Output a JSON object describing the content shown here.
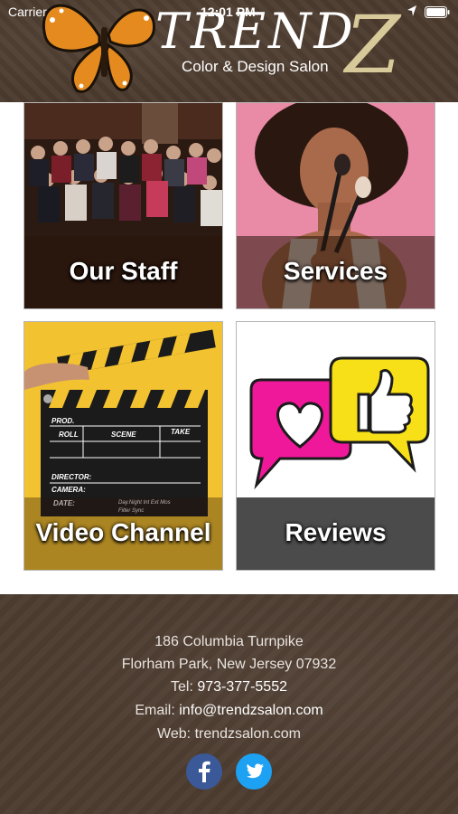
{
  "status_bar": {
    "carrier": "Carrier",
    "time": "12:01 PM"
  },
  "brand": {
    "name": "TREND",
    "z": "Z",
    "subtitle": "Color & Design Salon"
  },
  "tiles": [
    {
      "label": "Our Staff"
    },
    {
      "label": "Services"
    },
    {
      "label": "Video Channel"
    },
    {
      "label": "Reviews"
    }
  ],
  "clapper": {
    "prod": "PROD.",
    "roll": "ROLL",
    "scene": "SCENE",
    "take": "TAKE",
    "director": "DIRECTOR:",
    "camera": "CAMERA:",
    "date": "DATE:",
    "day": "Day.Night  Int  Ext  Mos",
    "filter": "Filter          Sync"
  },
  "footer": {
    "address1": "186 Columbia Turnpike",
    "address2": "Florham Park, New Jersey 07932",
    "tel_label": "Tel:",
    "tel_value": "973-377-5552",
    "email_label": "Email:",
    "email_value": "info@trendzsalon.com",
    "web_label": "Web:",
    "web_value": "trendzsalon.com"
  },
  "colors": {
    "brown": "#4b3a2d",
    "facebook": "#3b5998",
    "twitter": "#1da1f2",
    "heart_bubble": "#f0189a",
    "thumb_bubble": "#f7e017"
  },
  "icons": [
    "location-arrow-icon",
    "battery-icon",
    "butterfly-logo",
    "facebook-icon",
    "twitter-icon",
    "heart-icon",
    "thumbs-up-icon"
  ]
}
